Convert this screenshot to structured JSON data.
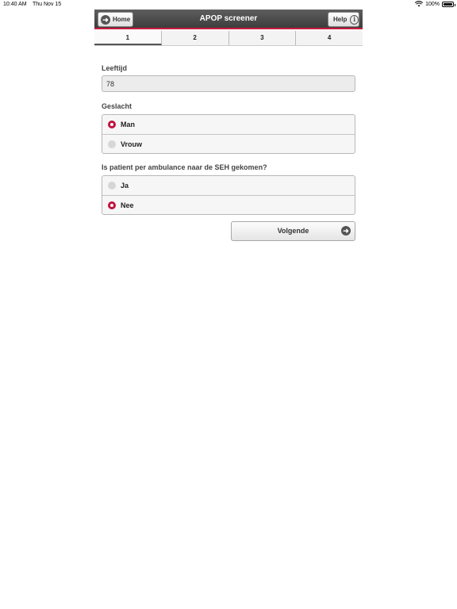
{
  "status_bar": {
    "time": "10:40 AM",
    "date": "Thu Nov 15",
    "battery": "100%"
  },
  "header": {
    "title": "APOP screener",
    "home_label": "Home",
    "help_label": "Help"
  },
  "tabs": [
    {
      "label": "1",
      "active": true
    },
    {
      "label": "2",
      "active": false
    },
    {
      "label": "3",
      "active": false
    },
    {
      "label": "4",
      "active": false
    }
  ],
  "form": {
    "age": {
      "label": "Leeftijd",
      "value": "78"
    },
    "gender": {
      "label": "Geslacht",
      "options": [
        {
          "label": "Man",
          "selected": true
        },
        {
          "label": "Vrouw",
          "selected": false
        }
      ]
    },
    "ambulance": {
      "label": "Is patient per ambulance naar de SEH gekomen?",
      "options": [
        {
          "label": "Ja",
          "selected": false
        },
        {
          "label": "Nee",
          "selected": true
        }
      ]
    },
    "next_label": "Volgende"
  },
  "colors": {
    "accent": "#c0143c",
    "header": "#4a4a4a"
  },
  "icons": {
    "home": "arrow-left-circle-icon",
    "help": "info-icon",
    "next": "arrow-right-circle-icon"
  }
}
